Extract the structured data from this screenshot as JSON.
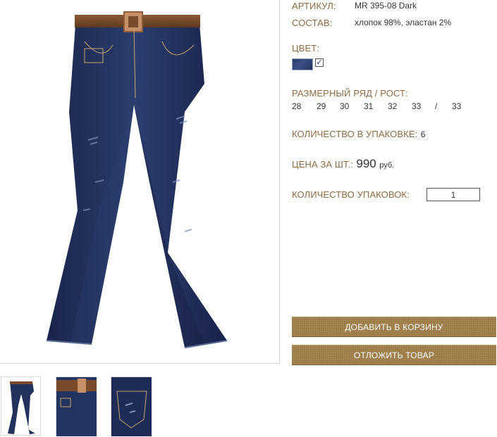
{
  "product": {
    "article_label": "АРТИКУЛ:",
    "article_value": "MR 395-08 Dark",
    "composition_label": "СОСТАВ:",
    "composition_value": "хлопок 98%, эластан 2%",
    "color_label": "ЦВЕТ:",
    "color_swatch": "#2e3f72",
    "color_checked": "✓",
    "sizes_label": "РАЗМЕРНЫЙ РЯД / РОСТ:",
    "sizes": [
      "28",
      "29",
      "30",
      "31",
      "32",
      "33",
      "/",
      "33"
    ],
    "pack_label": "КОЛИЧЕСТВО В УПАКОВКЕ:",
    "pack_value": "6",
    "price_label": "ЦЕНА ЗА ШТ.:",
    "price_value": "990",
    "price_currency": "руб.",
    "pack_count_label": "КОЛИЧЕСТВО УПАКОВОК:",
    "pack_count_value": "1"
  },
  "actions": {
    "add_to_cart": "ДОБАВИТЬ В КОРЗИНУ",
    "save_item": "ОТЛОЖИТЬ ТОВАР"
  },
  "colors": {
    "label": "#8b6a42",
    "button": "#9c7a45",
    "denim": "#1f2d55",
    "belt": "#7a4b2a"
  },
  "gallery": {
    "thumbnails": [
      "jeans-full-view",
      "belt-closeup",
      "pocket-closeup"
    ]
  }
}
